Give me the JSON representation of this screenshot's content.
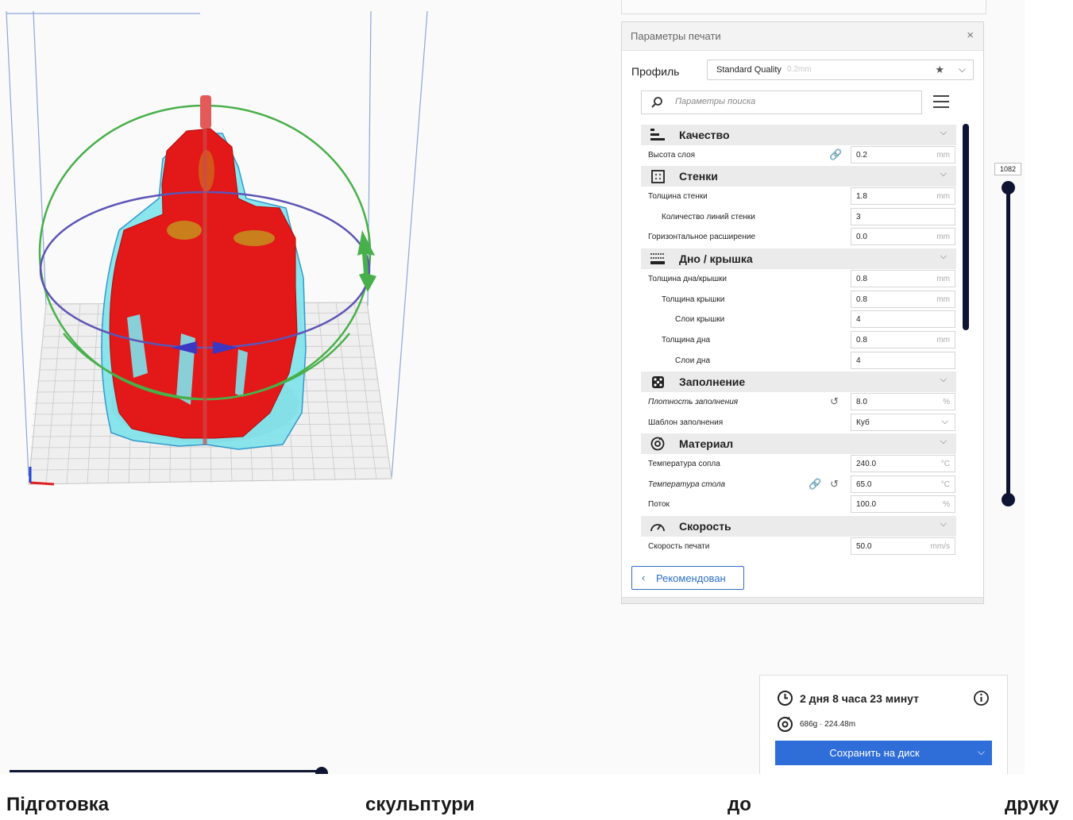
{
  "panel": {
    "title": "Параметры печати",
    "close_icon": "×",
    "profile": {
      "label": "Профиль",
      "name": "Standard Quality",
      "layer_height": "0.2mm"
    },
    "search": {
      "placeholder": "Параметры поиска"
    },
    "sections": {
      "quality": {
        "label": "Качество",
        "icon": "quality-icon",
        "layer_height": {
          "label": "Высота слоя",
          "value": "0.2",
          "unit": "mm"
        }
      },
      "walls": {
        "label": "Стенки",
        "icon": "walls-icon",
        "wall_thickness": {
          "label": "Толщина стенки",
          "value": "1.8",
          "unit": "mm"
        },
        "wall_line_count": {
          "label": "Количество линий стенки",
          "value": "3"
        },
        "horizontal_expansion": {
          "label": "Горизонтальное расширение",
          "value": "0.0",
          "unit": "mm"
        }
      },
      "top_bottom": {
        "label": "Дно / крышка",
        "icon": "top-bottom-icon",
        "top_bottom_thickness": {
          "label": "Толщина дна/крышки",
          "value": "0.8",
          "unit": "mm"
        },
        "top_thickness": {
          "label": "Толщина крышки",
          "value": "0.8",
          "unit": "mm"
        },
        "top_layers": {
          "label": "Слои крышки",
          "value": "4"
        },
        "bottom_thickness": {
          "label": "Толщина дна",
          "value": "0.8",
          "unit": "mm"
        },
        "bottom_layers": {
          "label": "Слои дна",
          "value": "4"
        }
      },
      "infill": {
        "label": "Заполнение",
        "icon": "infill-icon",
        "infill_density": {
          "label": "Плотность заполнения",
          "value": "8.0",
          "unit": "%"
        },
        "infill_pattern": {
          "label": "Шаблон заполнения",
          "value": "Куб"
        }
      },
      "material": {
        "label": "Материал",
        "icon": "material-icon",
        "nozzle_temp": {
          "label": "Температура сопла",
          "value": "240.0",
          "unit": "°C"
        },
        "bed_temp": {
          "label": "Температура стола",
          "value": "65.0",
          "unit": "°C"
        },
        "flow": {
          "label": "Поток",
          "value": "100.0",
          "unit": "%"
        }
      },
      "speed": {
        "label": "Скорость",
        "icon": "speed-icon",
        "print_speed": {
          "label": "Скорость печати",
          "value": "50.0",
          "unit": "mm/s"
        }
      }
    },
    "recommended_button": "Рекомендован"
  },
  "layer_slider": {
    "value": "1082"
  },
  "print_info": {
    "time": "2 дня 8 часа 23 минут",
    "material_usage": "686g · 224.48m",
    "save_button": "Сохранить на диск"
  },
  "caption": {
    "word1": "Підготовка",
    "word2": "скульптури",
    "word3": "до",
    "word4": "друку"
  }
}
